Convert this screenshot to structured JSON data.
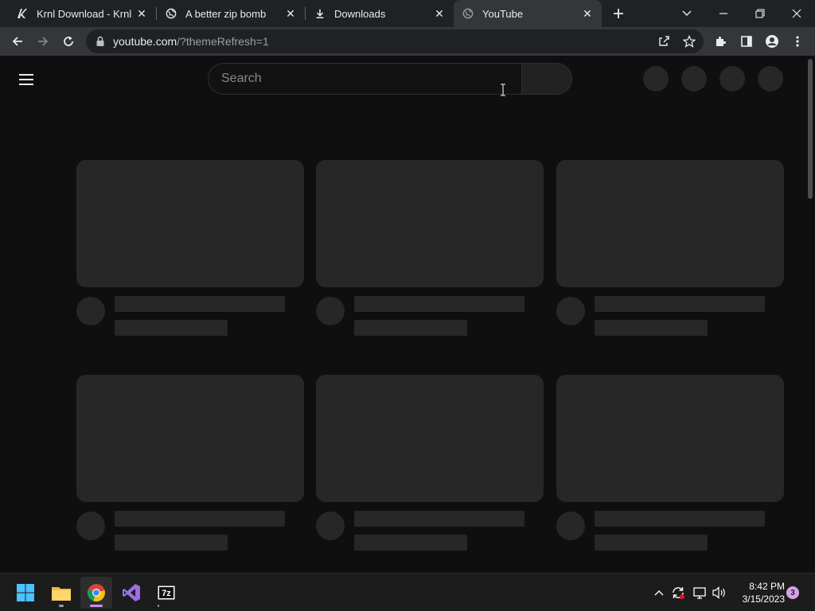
{
  "tabs": [
    {
      "title": "Krnl Download - Krnl",
      "icon": "krnl-favicon"
    },
    {
      "title": "A better zip bomb",
      "icon": "globe-icon"
    },
    {
      "title": "Downloads",
      "icon": "download-icon"
    },
    {
      "title": "YouTube",
      "icon": "globe-icon",
      "active": true
    }
  ],
  "address_bar": {
    "host": "youtube.com",
    "path": "/?themeRefresh=1"
  },
  "youtube": {
    "search_placeholder": "Search"
  },
  "taskbar": {
    "apps": [
      "windows-start-icon",
      "file-explorer-icon",
      "chrome-icon",
      "visual-studio-icon",
      "7zip-icon"
    ],
    "clock_time": "8:42 PM",
    "clock_date": "3/15/2023",
    "notification_count": "3",
    "seven_zip_label": "7z"
  },
  "colors": {
    "skeleton": "#272727",
    "page_bg": "#0f0f0f",
    "toolbar": "#35363a",
    "tabstrip": "#202124"
  }
}
